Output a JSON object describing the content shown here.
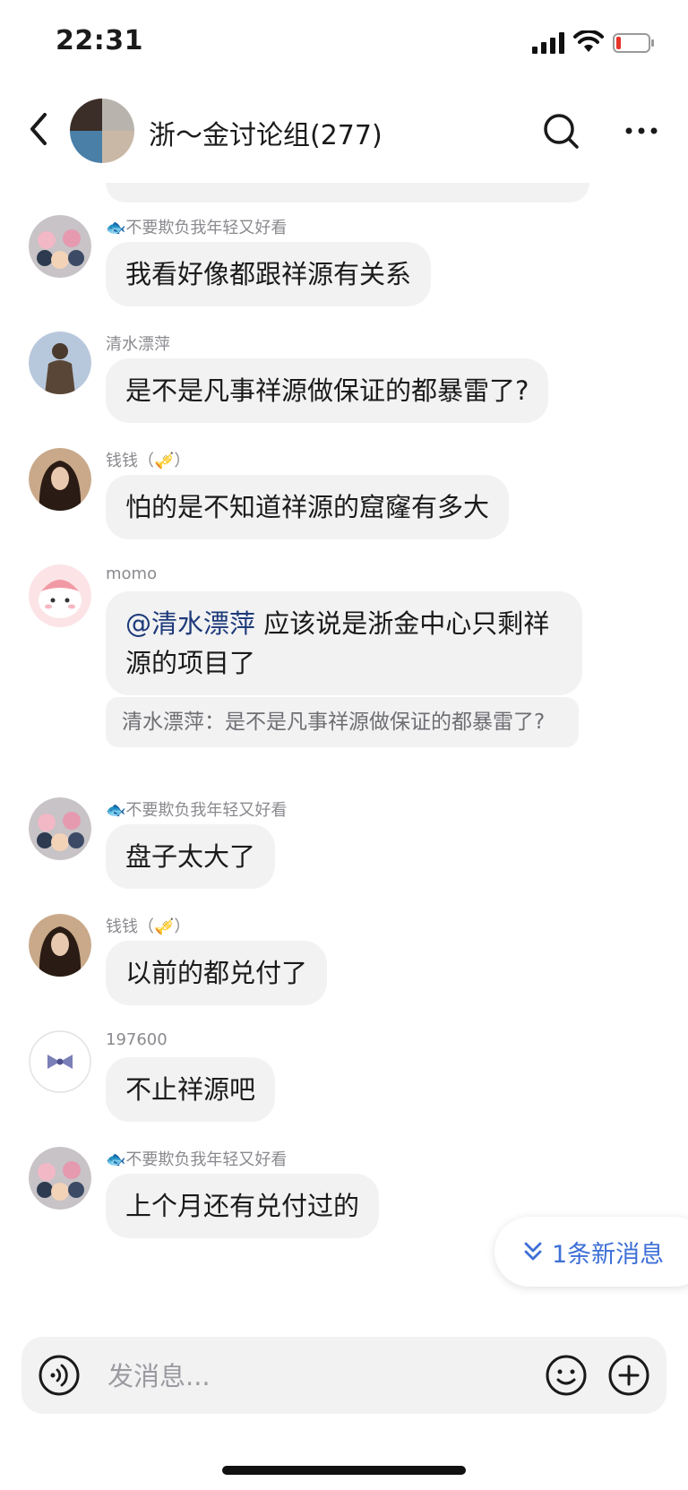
{
  "status_bar": {
    "time": "22:31",
    "battery_color": "#e5342b"
  },
  "header": {
    "title": "浙～金讨论组(277)"
  },
  "messages": [
    {
      "sender_prefix": "🐟",
      "sender": "不要欺负我年轻又好看",
      "text": "我看好像都跟祥源有关系",
      "avatar": "dolls-avatar"
    },
    {
      "sender": "清水漂萍",
      "text": "是不是凡事祥源做保证的都暴雷了?",
      "avatar": "statue-avatar"
    },
    {
      "sender": "钱钱（🎺）",
      "text": "怕的是不知道祥源的窟窿有多大",
      "avatar": "girl-avatar"
    },
    {
      "sender": "momo",
      "mention": "@清水漂萍",
      "text": " 应该说是浙金中心只剩祥源的项目了",
      "quote": "清水漂萍：是不是凡事祥源做保证的都暴雷了?",
      "avatar": "cartoon-avatar"
    },
    {
      "sender_prefix": "🐟",
      "sender": "不要欺负我年轻又好看",
      "text": "盘子太大了",
      "avatar": "dolls-avatar"
    },
    {
      "sender": "钱钱（🎺）",
      "text": "以前的都兑付了",
      "avatar": "girl-avatar"
    },
    {
      "sender": "197600",
      "text": "不止祥源吧",
      "avatar": "bow-avatar"
    },
    {
      "sender_prefix": "🐟",
      "sender": "不要欺负我年轻又好看",
      "text": "上个月还有兑付过的",
      "avatar": "dolls-avatar"
    }
  ],
  "new_messages": {
    "label": "1条新消息",
    "color": "#3d6fd6"
  },
  "composer": {
    "placeholder": "发消息..."
  },
  "colors": {
    "bubble": "#f2f2f3",
    "mention": "#1e3a7a"
  }
}
